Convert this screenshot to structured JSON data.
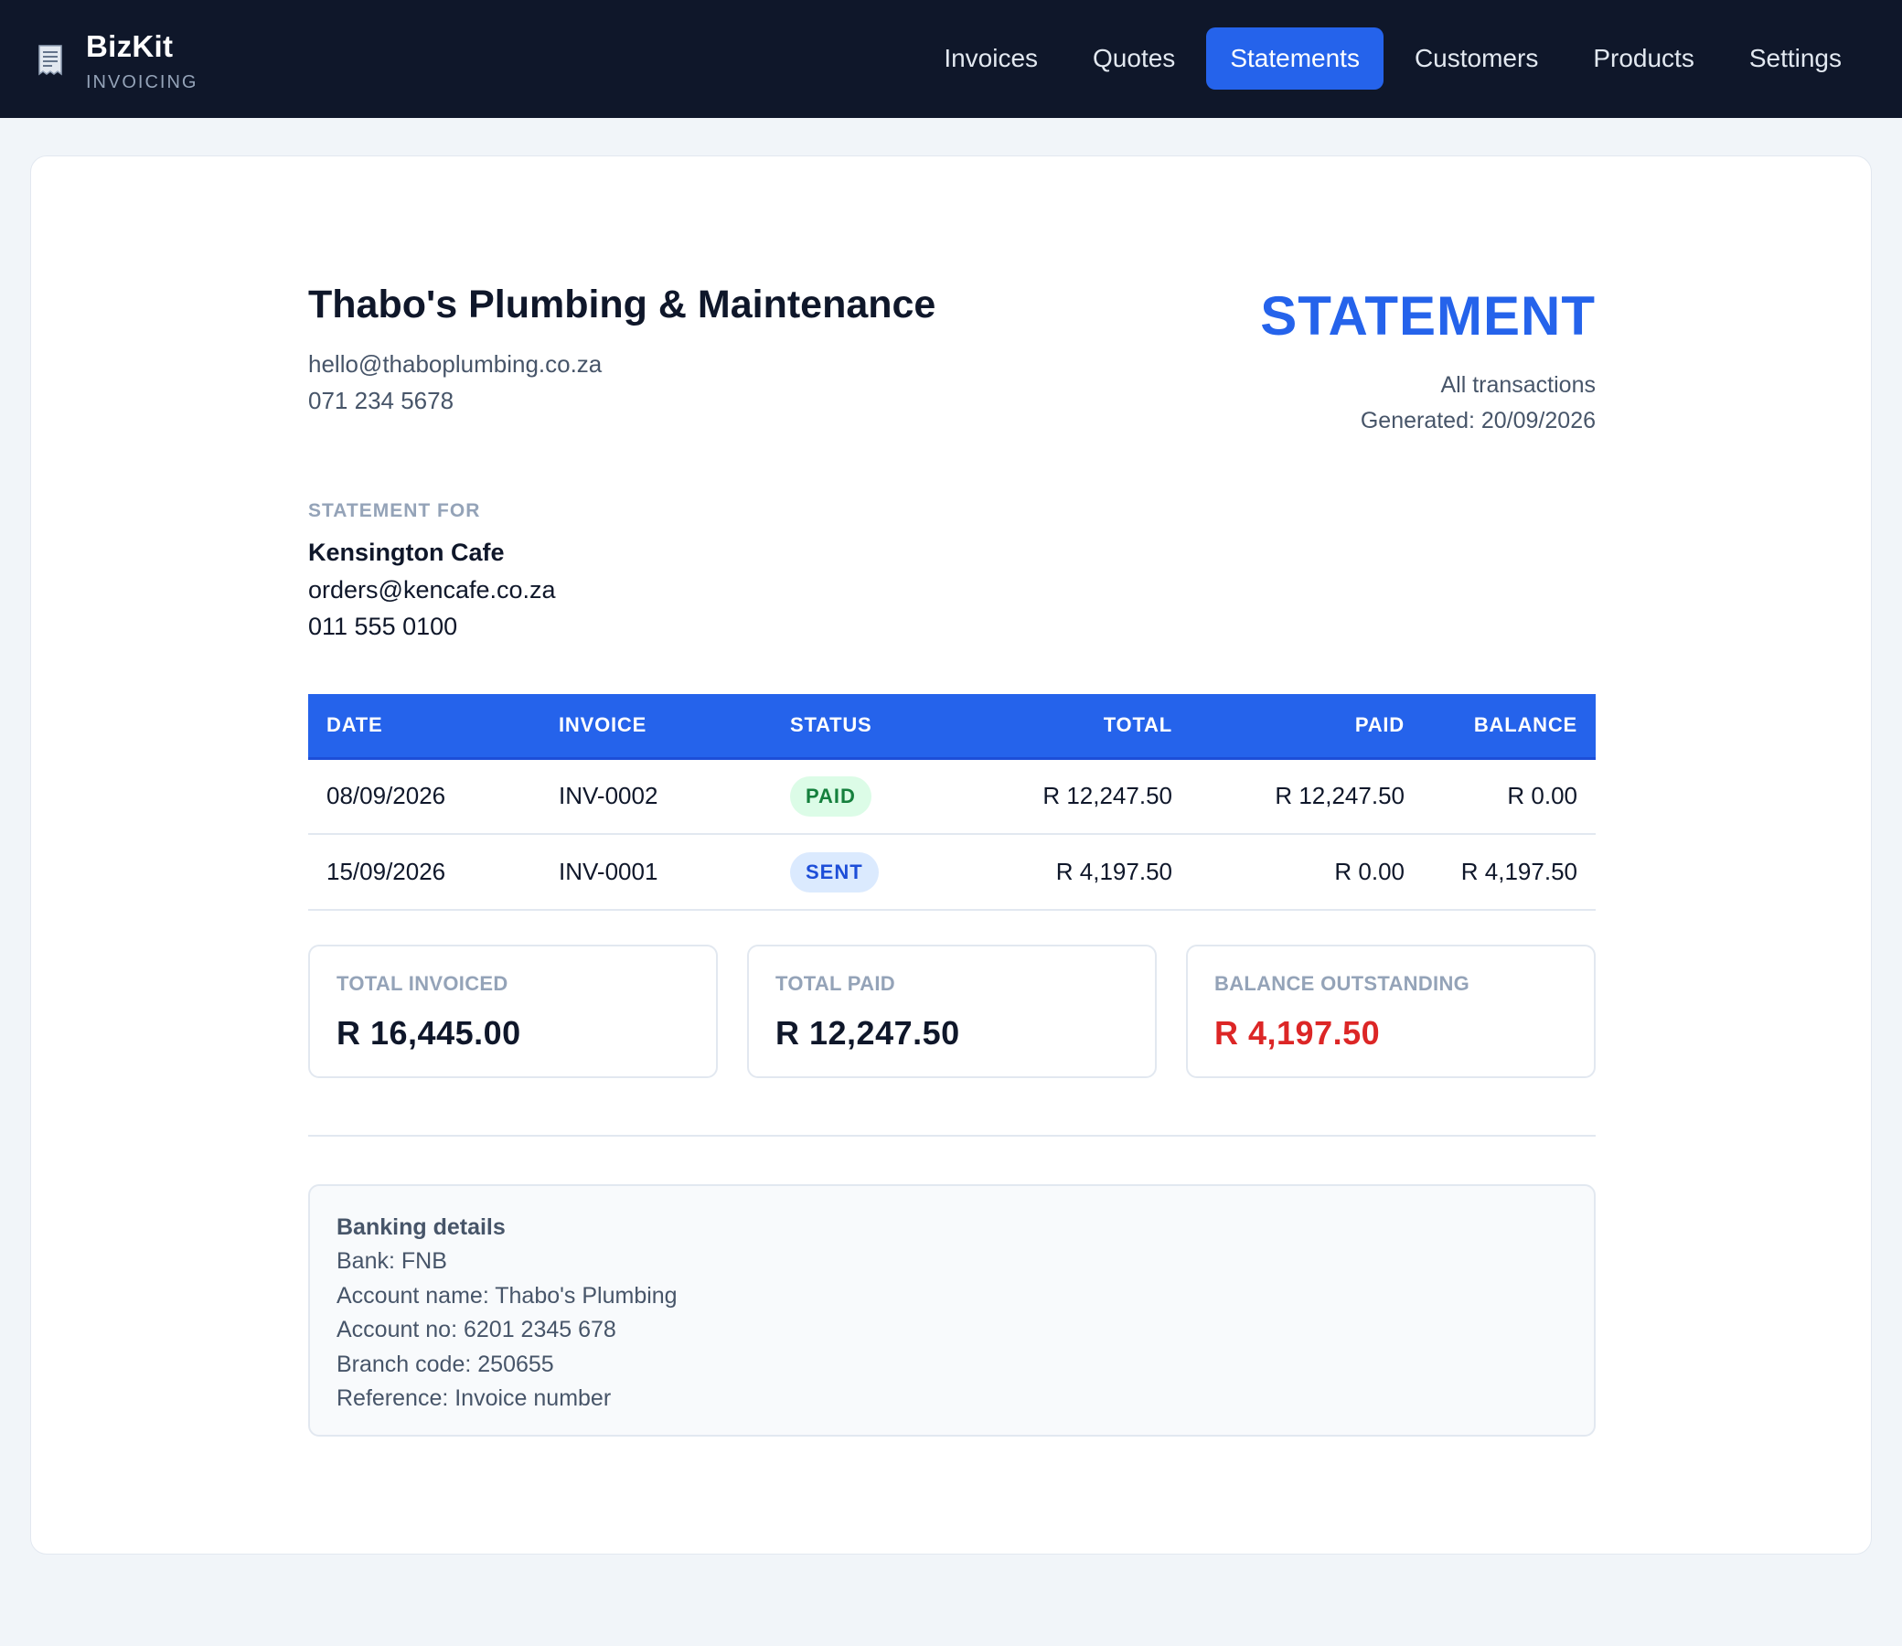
{
  "app": {
    "name": "BizKit",
    "subtitle": "INVOICING"
  },
  "nav": {
    "items": [
      {
        "label": "Invoices",
        "active": false
      },
      {
        "label": "Quotes",
        "active": false
      },
      {
        "label": "Statements",
        "active": true
      },
      {
        "label": "Customers",
        "active": false
      },
      {
        "label": "Products",
        "active": false
      },
      {
        "label": "Settings",
        "active": false
      }
    ]
  },
  "company": {
    "name": "Thabo's Plumbing & Maintenance",
    "email": "hello@thaboplumbing.co.za",
    "phone": "071 234 5678"
  },
  "document": {
    "title": "STATEMENT",
    "range": "All transactions",
    "generated": "Generated: 20/09/2026"
  },
  "customer": {
    "label": "STATEMENT FOR",
    "name": "Kensington Cafe",
    "email": "orders@kencafe.co.za",
    "phone": "011 555 0100"
  },
  "table": {
    "headers": {
      "date": "DATE",
      "invoice": "INVOICE",
      "status": "STATUS",
      "total": "TOTAL",
      "paid": "PAID",
      "balance": "BALANCE"
    },
    "rows": [
      {
        "date": "08/09/2026",
        "invoice": "INV-0002",
        "status": "PAID",
        "total": "R 12,247.50",
        "paid": "R 12,247.50",
        "balance": "R 0.00"
      },
      {
        "date": "15/09/2026",
        "invoice": "INV-0001",
        "status": "SENT",
        "total": "R 4,197.50",
        "paid": "R 0.00",
        "balance": "R 4,197.50"
      }
    ]
  },
  "summary": {
    "invoiced_label": "TOTAL INVOICED",
    "invoiced_value": "R 16,445.00",
    "paid_label": "TOTAL PAID",
    "paid_value": "R 12,247.50",
    "outstanding_label": "BALANCE OUTSTANDING",
    "outstanding_value": "R 4,197.50"
  },
  "banking": {
    "title": "Banking details",
    "lines": [
      "Bank: FNB",
      "Account name: Thabo's Plumbing",
      "Account no: 6201 2345 678",
      "Branch code: 250655",
      "Reference: Invoice number"
    ]
  },
  "colors": {
    "nav_bg": "#0f172a",
    "accent": "#2563eb",
    "paid_badge": "#15803d",
    "sent_badge": "#1d4ed8",
    "outstanding": "#dc2626"
  }
}
